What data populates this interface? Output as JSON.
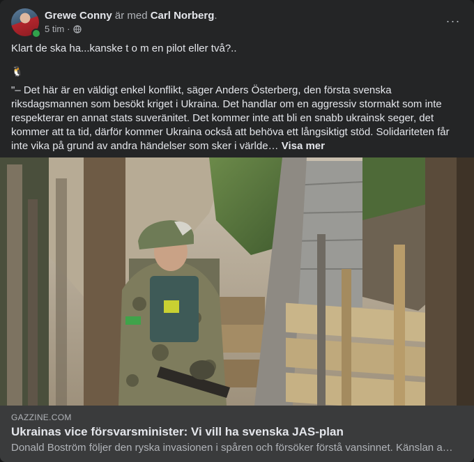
{
  "post": {
    "author": "Grewe Conny",
    "with_text": "är med",
    "tagged": "Carl Norberg",
    "period": ".",
    "time": "5 tim",
    "dot": "·",
    "more_icon": "···",
    "text_line1": "Klart de ska ha...kanske t o m en pilot eller två?..",
    "emoji": "🐧",
    "quote": "\"– Det här är en väldigt enkel konflikt, säger Anders Österberg, den första svenska riksdagsmannen som besökt kriget i Ukraina. Det handlar om en aggressiv stormakt som inte respekterar en annat stats suveränitet. Det kommer inte att bli en snabb ukrainsk seger, det kommer att ta tid, därför kommer Ukraina också att behöva ett långsiktigt stöd. Solidariteten får inte vika på grund av andra händelser som sker i världe…",
    "see_more": "Visa mer"
  },
  "link": {
    "domain": "GAZZINE.COM",
    "title": "Ukrainas vice försvarsminister: Vi vill ha svenska JAS-plan",
    "description": "Donald Boström följer den ryska invasionen i spåren och försöker förstå vansinnet. Känslan a…"
  },
  "colors": {
    "card": "#242526",
    "link_bg": "#3a3b3c",
    "online": "#31a24c"
  }
}
